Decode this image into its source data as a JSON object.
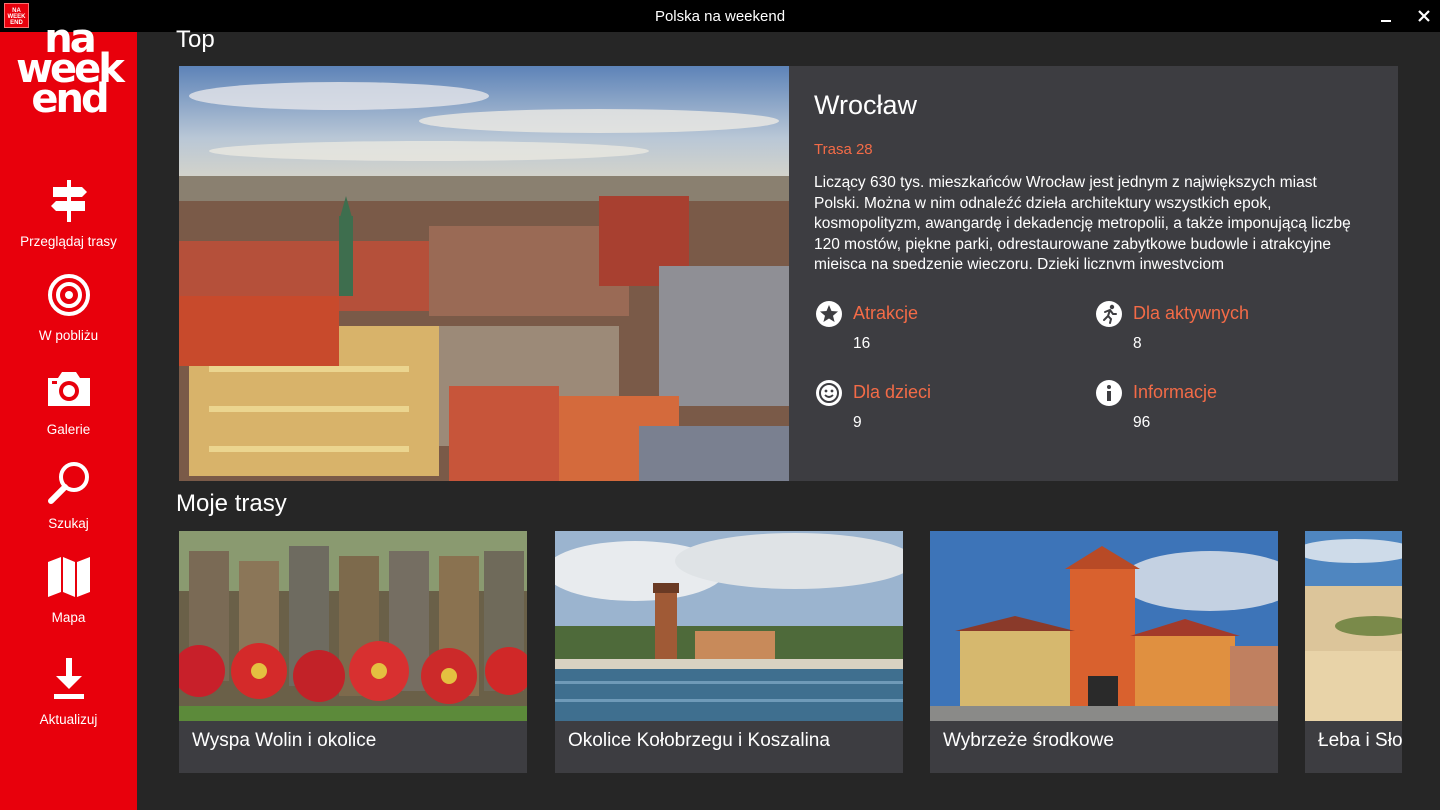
{
  "window": {
    "title": "Polska na weekend",
    "app_icon_text": "na weekend"
  },
  "sidebar": {
    "logo_lines": [
      "na",
      "week",
      "end"
    ],
    "items": [
      {
        "label": "Przeglądaj trasy",
        "icon": "signpost-icon"
      },
      {
        "label": "W pobliżu",
        "icon": "target-icon"
      },
      {
        "label": "Galerie",
        "icon": "camera-icon"
      },
      {
        "label": "Szukaj",
        "icon": "search-icon"
      },
      {
        "label": "Mapa",
        "icon": "map-icon"
      },
      {
        "label": "Aktualizuj",
        "icon": "download-icon"
      }
    ]
  },
  "top": {
    "section_title": "Top",
    "city": "Wrocław",
    "route": "Trasa 28",
    "description": "Liczący 630 tys. mieszkańców Wrocław jest jednym z największych miast Polski. Można w nim odnaleźć dzieła architektury wszystkich epok, kosmopolityzm, awangardę i dekadencję metropolii, a także imponującą liczbę 120 mostów, piękne parki, odrestaurowane zabytkowe budowle i atrakcyjne miejsca na spędzenie wieczoru. Dzięki licznym inwestycjom",
    "stats": [
      {
        "label": "Atrakcje",
        "value": "16",
        "icon": "star-icon"
      },
      {
        "label": "Dla aktywnych",
        "value": "8",
        "icon": "runner-icon"
      },
      {
        "label": "Dla dzieci",
        "value": "9",
        "icon": "smiley-icon"
      },
      {
        "label": "Informacje",
        "value": "96",
        "icon": "info-icon"
      }
    ]
  },
  "my_routes": {
    "section_title": "Moje trasy",
    "items": [
      {
        "name": "Wyspa Wolin i okolice"
      },
      {
        "name": "Okolice Kołobrzegu i Koszalina"
      },
      {
        "name": "Wybrzeże środkowe"
      },
      {
        "name": "Łeba i Słowiński"
      }
    ]
  },
  "colors": {
    "accent": "#e8000c",
    "highlight": "#f36b47",
    "card": "#3d3d41",
    "background": "#262626"
  }
}
